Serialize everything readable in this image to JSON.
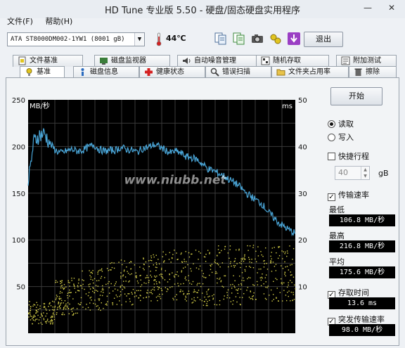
{
  "window": {
    "title": "HD Tune 专业版 5.50 - 硬盘/固态硬盘实用程序",
    "minimize": "—",
    "close": "✕"
  },
  "menu": [
    "文件(F)",
    "帮助(H)"
  ],
  "toolbar": {
    "drive": "ATA    ST8000DM002-1YW1 (8001 gB)",
    "temperature": "44℃",
    "exit_label": "退出"
  },
  "tabs_top": [
    "文件基准",
    "磁盘监视器",
    "自动噪音管理",
    "随机存取",
    "附加测试"
  ],
  "tabs_bottom": [
    "基准",
    "磁盘信息",
    "健康状态",
    "错误扫描",
    "文件夹占用率",
    "擦除"
  ],
  "colors": {
    "chart_bg": "#000000",
    "grid": "#3a3a3a",
    "transfer_line": "#4aa6d8",
    "access_points": "#d9d34a"
  },
  "chart_data": {
    "type": "line",
    "y_left": {
      "label": "MB/秒",
      "ticks": [
        250,
        200,
        150,
        100,
        50
      ],
      "range": [
        0,
        250
      ]
    },
    "y_right": {
      "label": "ms",
      "ticks": [
        50,
        40,
        30,
        20,
        10
      ],
      "range": [
        0,
        50
      ]
    },
    "watermark": "www.niubb.net",
    "transfer_rate_mb_s": [
      158,
      205,
      212,
      214,
      203,
      196,
      193,
      195,
      197,
      195,
      196,
      199,
      202,
      197,
      195,
      196,
      196,
      199,
      197,
      196,
      194,
      198,
      199,
      202,
      200,
      197,
      193,
      195,
      193,
      189,
      188,
      186,
      181,
      176,
      174,
      171,
      168,
      164,
      161,
      156,
      150,
      146,
      142,
      138,
      130,
      124,
      118,
      114,
      110,
      107
    ],
    "access_time_ms_band": [
      [
        2,
        7
      ],
      [
        4,
        12
      ],
      [
        5,
        14
      ],
      [
        6,
        16
      ],
      [
        7,
        17
      ],
      [
        7,
        18
      ],
      [
        6,
        18
      ],
      [
        6,
        19
      ],
      [
        7,
        19
      ],
      [
        7,
        19
      ]
    ]
  },
  "side": {
    "start": "开始",
    "read": "读取",
    "write": "写入",
    "quick_run": "快捷行程",
    "quick_value": "40",
    "quick_unit": "gB",
    "transfer_rate": "传输速率",
    "min_label": "最低",
    "min_value": "106.8 MB/秒",
    "max_label": "最高",
    "max_value": "216.8 MB/秒",
    "avg_label": "平均",
    "avg_value": "175.6 MB/秒",
    "access_time": "存取时间",
    "access_value": "13.6 ms",
    "burst_rate": "突发传输速率",
    "burst_value": "98.0 MB/秒"
  }
}
